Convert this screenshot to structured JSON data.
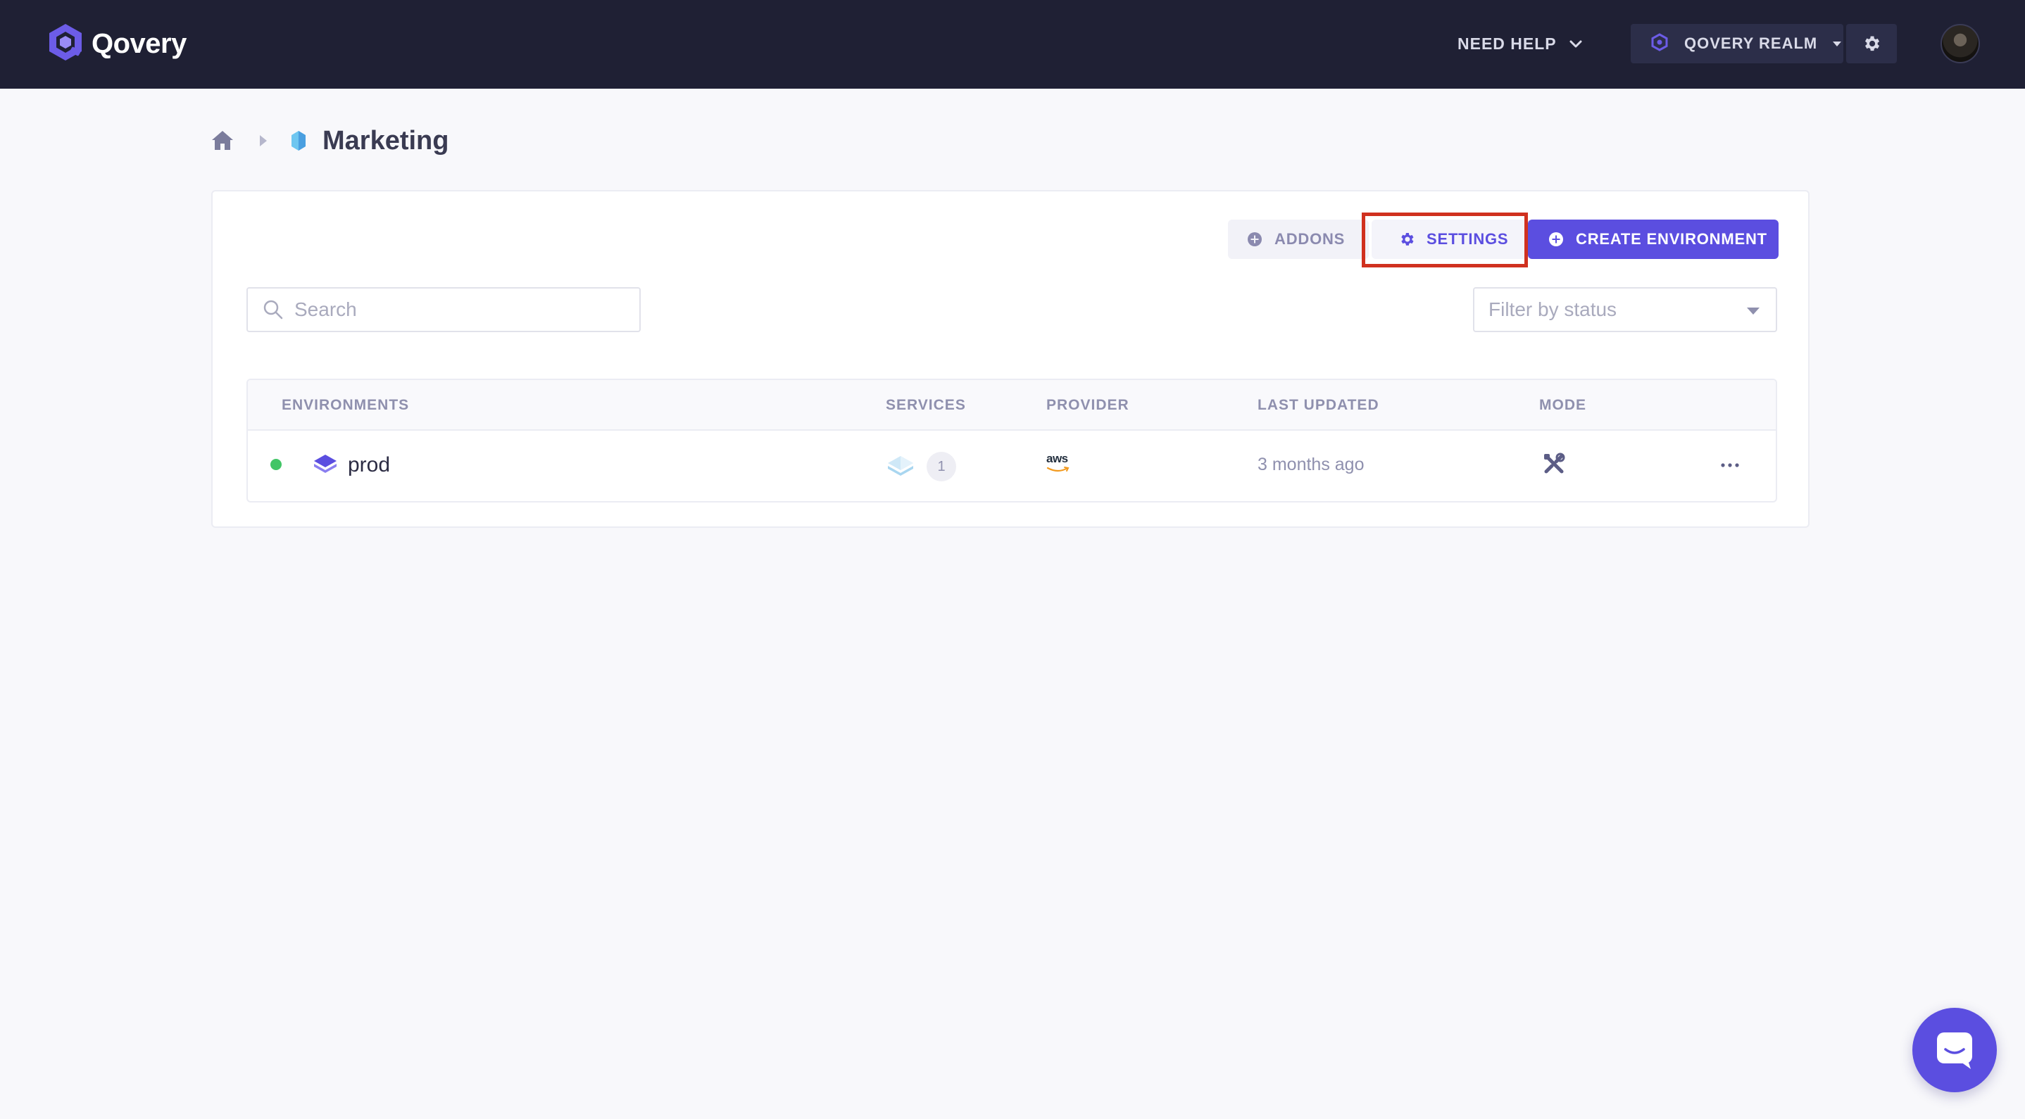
{
  "header": {
    "logo_text": "Qovery",
    "help_label": "NEED HELP",
    "realm_label": "QOVERY REALM"
  },
  "breadcrumb": {
    "page_title": "Marketing"
  },
  "toolbar": {
    "addons_label": "ADDONS",
    "settings_label": "SETTINGS",
    "create_label": "CREATE ENVIRONMENT"
  },
  "search": {
    "placeholder": "Search"
  },
  "filter": {
    "placeholder": "Filter by status"
  },
  "table": {
    "columns": [
      "ENVIRONMENTS",
      "SERVICES",
      "PROVIDER",
      "LAST UPDATED",
      "MODE"
    ],
    "rows": [
      {
        "name": "prod",
        "status": "running",
        "services_count": "1",
        "provider": "aws",
        "last_updated": "3 months ago",
        "mode": "development"
      }
    ]
  },
  "colors": {
    "navbar": "#1f2034",
    "primary": "#5b4ee0",
    "status_running": "#42c566",
    "highlight": "#d0311f"
  },
  "icons": {
    "logo": "qovery-logo-icon",
    "home": "home-icon",
    "settings": "gear-icon",
    "addons": "plus-circle-icon",
    "search": "search-icon",
    "mode": "tools-icon",
    "more": "more-horizontal-icon",
    "chat": "chat-icon"
  }
}
